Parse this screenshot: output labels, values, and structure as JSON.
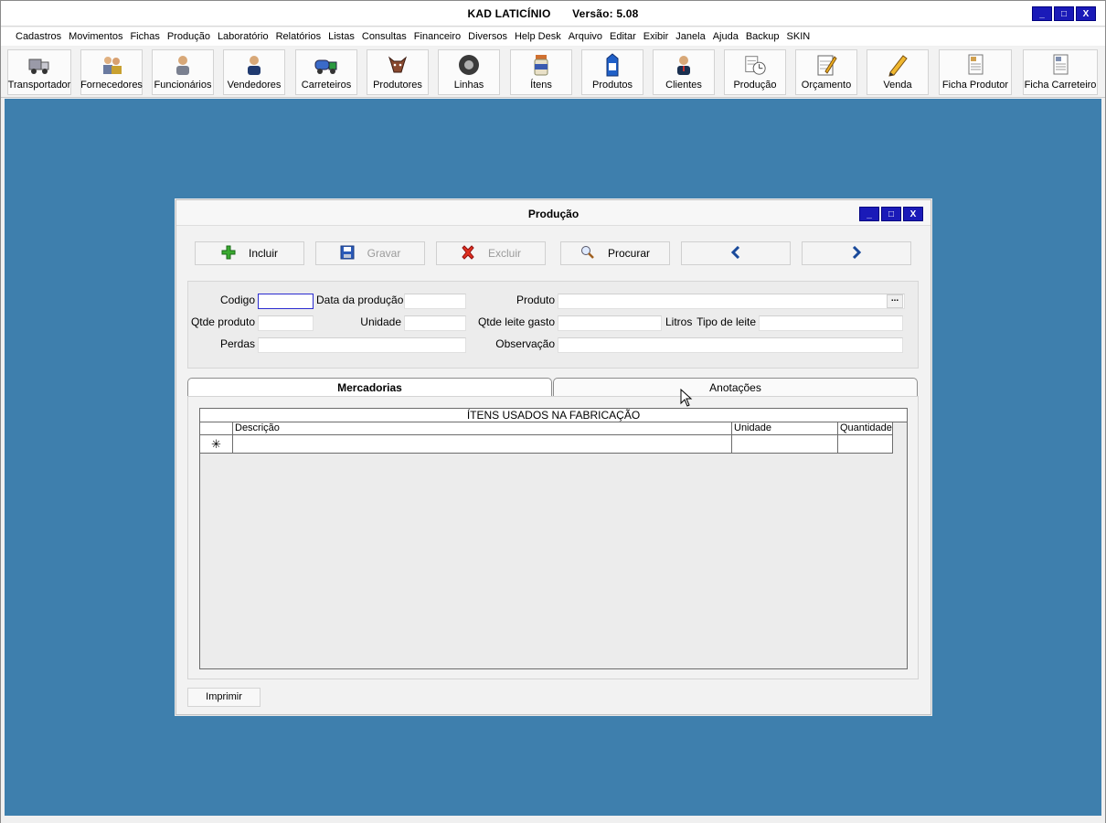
{
  "app": {
    "title": "KAD LATICÍNIO",
    "version": "Versão: 5.08"
  },
  "menu": [
    "Cadastros",
    "Movimentos",
    "Fichas",
    "Produção",
    "Laboratório",
    "Relatórios",
    "Listas",
    "Consultas",
    "Financeiro",
    "Diversos",
    "Help Desk",
    "Arquivo",
    "Editar",
    "Exibir",
    "Janela",
    "Ajuda",
    "Backup",
    "SKIN"
  ],
  "toolbar": {
    "items": [
      {
        "label": "Transportador",
        "icon": "truck-icon"
      },
      {
        "label": "Fornecedores",
        "icon": "people-icon"
      },
      {
        "label": "Funcionários",
        "icon": "person-icon"
      },
      {
        "label": "Vendedores",
        "icon": "salesman-icon"
      },
      {
        "label": "Carreteiros",
        "icon": "tanker-truck-icon"
      },
      {
        "label": "Produtores",
        "icon": "cow-icon"
      },
      {
        "label": "Linhas",
        "icon": "tire-icon"
      },
      {
        "label": "Ítens",
        "icon": "jar-icon"
      },
      {
        "label": "Produtos",
        "icon": "milk-carton-icon"
      },
      {
        "label": "Clientes",
        "icon": "client-icon"
      },
      {
        "label": "Produção",
        "icon": "clock-document-icon"
      },
      {
        "label": "Orçamento",
        "icon": "notepad-pencil-icon"
      },
      {
        "label": "Venda",
        "icon": "pencil-icon"
      },
      {
        "label": "Ficha Produtor",
        "icon": "document-icon"
      },
      {
        "label": "Ficha Carreteiro",
        "icon": "document-alt-icon"
      }
    ]
  },
  "window_controls": {
    "minimize": "_",
    "maximize": "□",
    "close": "X"
  },
  "producao": {
    "title": "Produção",
    "actions": {
      "incluir": "Incluir",
      "gravar": "Gravar",
      "excluir": "Excluir",
      "procurar": "Procurar"
    },
    "fields": {
      "codigo": {
        "label": "Codigo",
        "value": ""
      },
      "data_producao": {
        "label": "Data da produção",
        "value": ""
      },
      "produto": {
        "label": "Produto",
        "value": ""
      },
      "qtde_produto": {
        "label": "Qtde produto",
        "value": ""
      },
      "unidade": {
        "label": "Unidade",
        "value": ""
      },
      "qtde_leite_gasto": {
        "label": "Qtde leite gasto",
        "value": ""
      },
      "litros": {
        "label": "Litros"
      },
      "tipo_leite": {
        "label": "Tipo de leite",
        "value": ""
      },
      "perdas": {
        "label": "Perdas",
        "value": ""
      },
      "observacao": {
        "label": "Observação",
        "value": ""
      }
    },
    "ellipsis": "...",
    "tabs": [
      {
        "label": "Mercadorias",
        "active": true
      },
      {
        "label": "Anotações",
        "active": false
      }
    ],
    "grid": {
      "caption": "ÍTENS USADOS NA FABRICAÇÃO",
      "columns": [
        "Descrição",
        "Unidade",
        "Quantidade"
      ],
      "new_row_marker": "✳"
    },
    "print": "Imprimir"
  }
}
